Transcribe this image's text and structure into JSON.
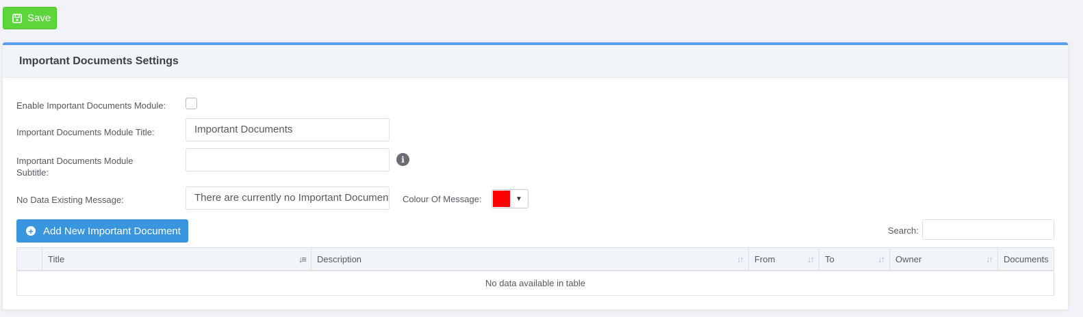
{
  "toolbar": {
    "save_label": "Save"
  },
  "panel": {
    "title": "Important Documents Settings"
  },
  "form": {
    "enable_label": "Enable Important Documents Module:",
    "enable_checked": false,
    "title_label": "Important Documents Module Title:",
    "title_value": "Important Documents",
    "subtitle_label_line1": "Important Documents Module",
    "subtitle_label_line2": "Subtitle:",
    "subtitle_value": "",
    "nodata_label": "No Data Existing Message:",
    "nodata_value": "There are currently no Important Documents",
    "colour_label": "Colour Of Message:",
    "colour_value": "#ff0000"
  },
  "actions": {
    "add_label": "Add New Important Document"
  },
  "search": {
    "label": "Search:",
    "value": ""
  },
  "table": {
    "columns": [
      "",
      "Title",
      "Description",
      "From",
      "To",
      "Owner",
      "Documents"
    ],
    "empty_message": "No data available in table"
  },
  "colors": {
    "accent": "#5c9ded",
    "save": "#5cd63a",
    "primary": "#3a95df"
  }
}
